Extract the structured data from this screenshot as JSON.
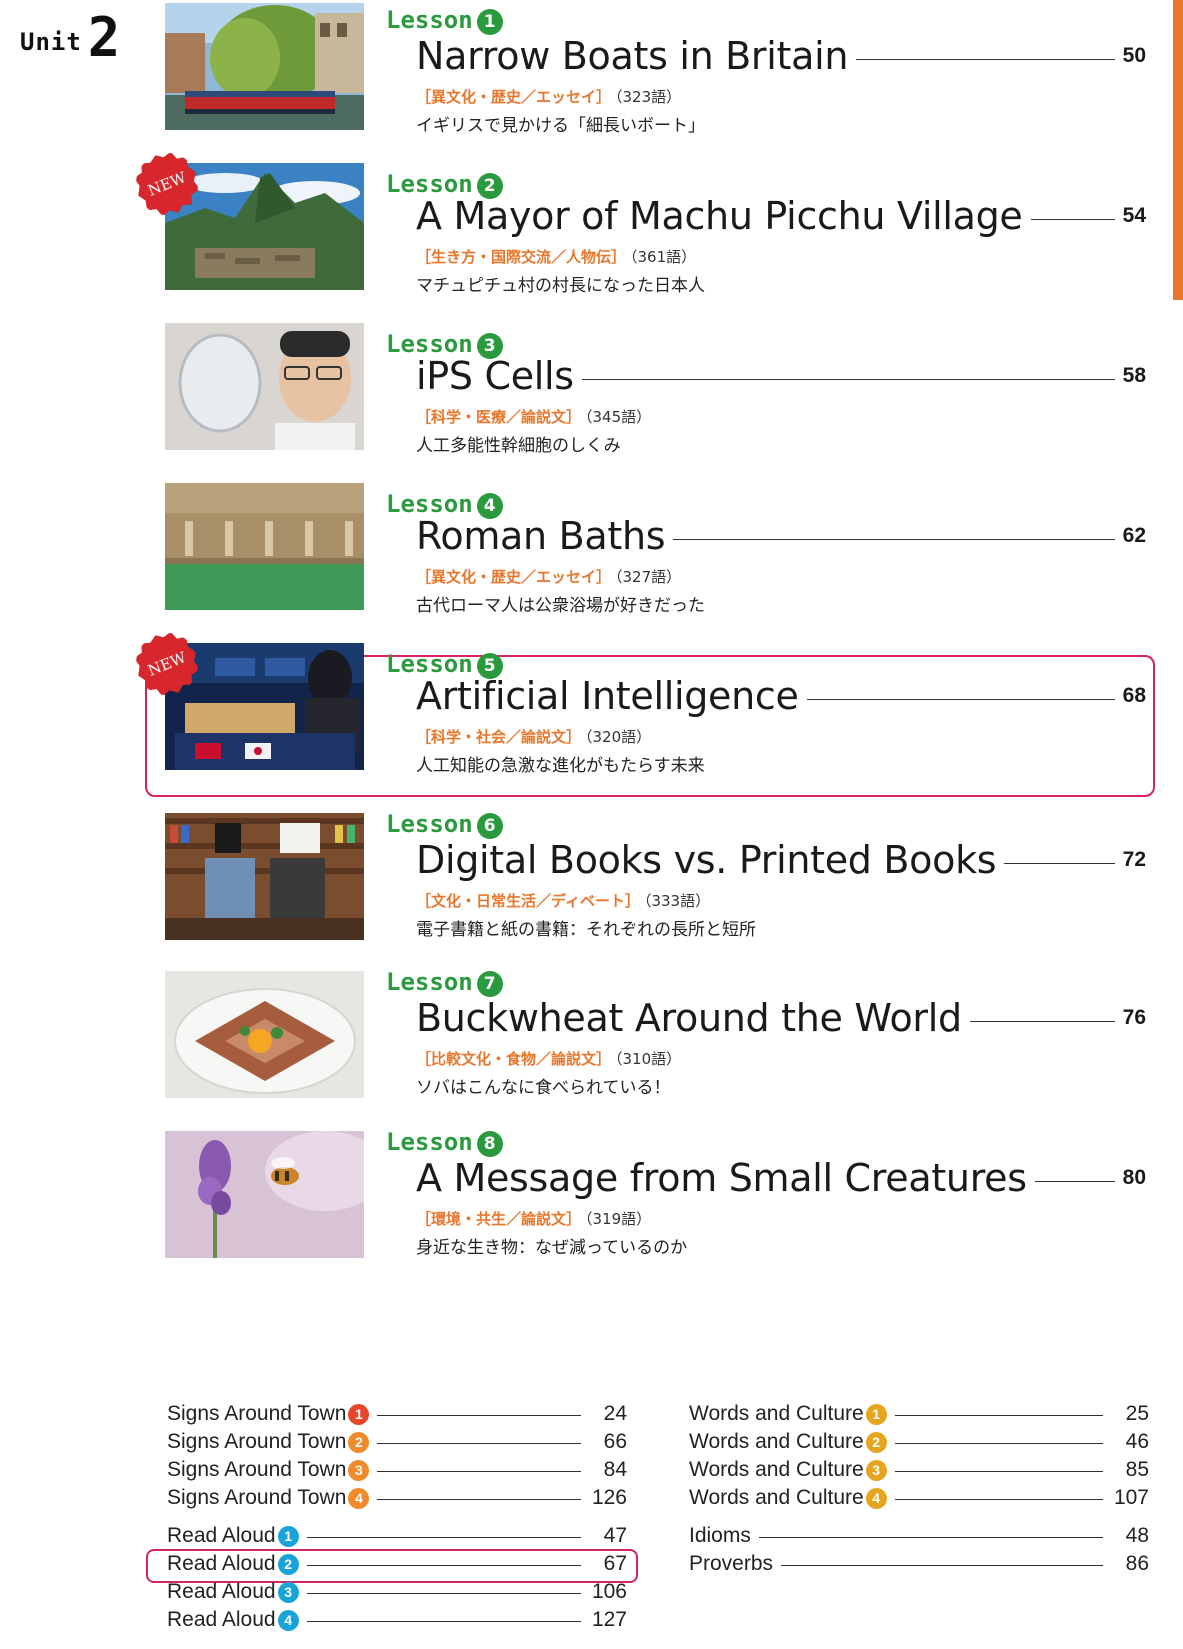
{
  "unit": {
    "word": "Unit",
    "number": "2"
  },
  "lessons": [
    {
      "label": "Lesson",
      "number": "1",
      "title": "Narrow Boats in Britain",
      "page": "50",
      "genre": "［異文化・歴史／エッセイ］",
      "words": "（323語）",
      "summary": "イギリスで見かける「細長いボート」",
      "is_new": false
    },
    {
      "label": "Lesson",
      "number": "2",
      "title": "A Mayor of Machu Picchu Village",
      "page": "54",
      "genre": "［生き方・国際交流／人物伝］",
      "words": "（361語）",
      "summary": "マチュピチュ村の村長になった日本人",
      "is_new": true,
      "badge": "NEW"
    },
    {
      "label": "Lesson",
      "number": "3",
      "title": "iPS Cells",
      "page": "58",
      "genre": "［科学・医療／論説文］",
      "words": "（345語）",
      "summary": "人工多能性幹細胞のしくみ",
      "is_new": false
    },
    {
      "label": "Lesson",
      "number": "4",
      "title": "Roman Baths",
      "page": "62",
      "genre": "［異文化・歴史／エッセイ］",
      "words": "（327語）",
      "summary": "古代ローマ人は公衆浴場が好きだった",
      "is_new": false
    },
    {
      "label": "Lesson",
      "number": "5",
      "title": "Artificial Intelligence",
      "page": "68",
      "genre": "［科学・社会／論説文］",
      "words": "（320語）",
      "summary": "人工知能の急激な進化がもたらす未来",
      "is_new": true,
      "badge": "NEW",
      "highlighted": true
    },
    {
      "label": "Lesson",
      "number": "6",
      "title": "Digital Books vs. Printed Books",
      "page": "72",
      "genre": "［文化・日常生活／ディベート］",
      "words": "（333語）",
      "summary": "電子書籍と紙の書籍：それぞれの長所と短所",
      "is_new": false
    },
    {
      "label": "Lesson",
      "number": "7",
      "title": "Buckwheat Around the World",
      "page": "76",
      "genre": "［比較文化・食物／論説文］",
      "words": "（310語）",
      "summary": "ソバはこんなに食べられている！",
      "is_new": false
    },
    {
      "label": "Lesson",
      "number": "8",
      "title": "A Message from Small Creatures",
      "page": "80",
      "genre": "［環境・共生／論説文］",
      "words": "（319語）",
      "summary": "身近な生き物：なぜ減っているのか",
      "is_new": false
    }
  ],
  "extras_left": {
    "signs": [
      {
        "label": "Signs Around Town",
        "num": "1",
        "page": "24"
      },
      {
        "label": "Signs Around Town",
        "num": "2",
        "page": "66"
      },
      {
        "label": "Signs Around Town",
        "num": "3",
        "page": "84"
      },
      {
        "label": "Signs Around Town",
        "num": "4",
        "page": "126"
      }
    ],
    "read_aloud": [
      {
        "label": "Read Aloud",
        "num": "1",
        "page": "47"
      },
      {
        "label": "Read Aloud",
        "num": "2",
        "page": "67"
      },
      {
        "label": "Read Aloud",
        "num": "3",
        "page": "106",
        "highlighted": true
      },
      {
        "label": "Read Aloud",
        "num": "4",
        "page": "127"
      }
    ]
  },
  "extras_right": {
    "words_culture": [
      {
        "label": "Words and Culture",
        "num": "1",
        "page": "25"
      },
      {
        "label": "Words and Culture",
        "num": "2",
        "page": "46"
      },
      {
        "label": "Words and Culture",
        "num": "3",
        "page": "85"
      },
      {
        "label": "Words and Culture",
        "num": "4",
        "page": "107"
      }
    ],
    "others": [
      {
        "label": "Idioms",
        "page": "48"
      },
      {
        "label": "Proverbs",
        "page": "86"
      }
    ]
  },
  "colors": {
    "lesson_green": "#2a9a3e",
    "genre_orange": "#e8762b",
    "highlight_pink": "#d6245f",
    "new_badge_red": "#d8262d",
    "signs_red": "#e8462b",
    "read_aloud_blue": "#1aa3d9",
    "words_culture_yellow": "#e5a51f"
  }
}
